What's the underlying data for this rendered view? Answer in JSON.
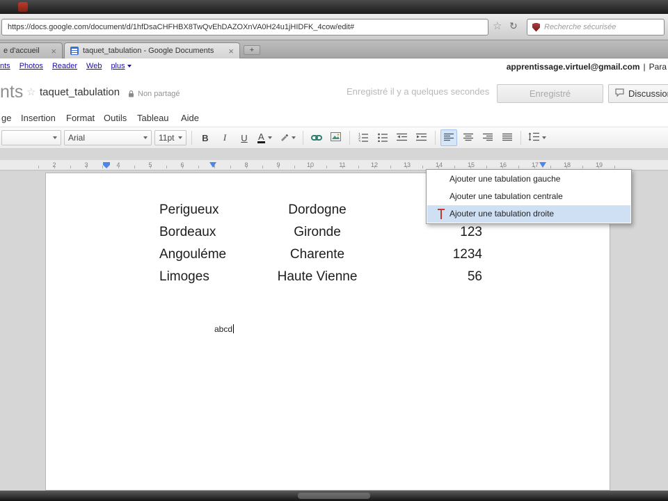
{
  "browser": {
    "url": "https://docs.google.com/document/d/1hfDsaCHFHBX8TwQvEhDAZOXnVA0H24u1jHIDFK_4cow/edit#",
    "search_placeholder": "Recherche sécurisée",
    "star_glyph": "☆",
    "reload_glyph": "↻",
    "tab_home": "e d'accueil",
    "tab_doc": "taquet_tabulation - Google Documents",
    "close_glyph": "×",
    "new_tab_glyph": "+"
  },
  "google_bar": {
    "links": [
      "nts",
      "Photos",
      "Reader",
      "Web",
      "plus"
    ],
    "account": "apprentissage.virtuel@gmail.com",
    "separator": "|",
    "settings": "Para"
  },
  "docs": {
    "logo_fragment": "nts",
    "star_glyph": "☆",
    "title": "taquet_tabulation",
    "share_status": "Non partagé",
    "save_status": "Enregistré il y a quelques secondes",
    "saved_button": "Enregistré",
    "discussion_button": "Discussion"
  },
  "menus": [
    "ge",
    "Insertion",
    "Format",
    "Outils",
    "Tableau",
    "Aide"
  ],
  "toolbar": {
    "styles_value": "",
    "font": "Arial",
    "size": "11pt",
    "bold_glyph": "B",
    "italic_glyph": "I",
    "underline_glyph": "U",
    "color_glyph": "A"
  },
  "ruler": {
    "numbers": [
      "2",
      "3",
      "4",
      "5",
      "6",
      "7",
      "8",
      "9",
      "10",
      "11",
      "12",
      "13",
      "14",
      "15",
      "16",
      "17",
      "18",
      "19"
    ]
  },
  "context_menu": {
    "items": [
      {
        "label": "Ajouter une tabulation gauche"
      },
      {
        "label": "Ajouter une tabulation centrale"
      },
      {
        "label": "Ajouter une tabulation droite"
      }
    ],
    "selected_index": 2
  },
  "document": {
    "rows": [
      {
        "c1": "Perigueux",
        "c2": "Dordogne",
        "c3": ""
      },
      {
        "c1": "Bordeaux",
        "c2": "Gironde",
        "c3": "123"
      },
      {
        "c1": "Angouléme",
        "c2": "Charente",
        "c3": "1234"
      },
      {
        "c1": "Limoges",
        "c2": "Haute Vienne",
        "c3": "56"
      }
    ],
    "typed_text": "abcd"
  }
}
